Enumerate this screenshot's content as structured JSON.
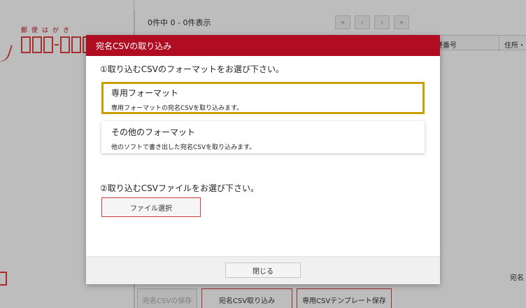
{
  "postcard": {
    "label": "郵便はがき"
  },
  "list": {
    "count_text": "0件中 0 - 0件表示",
    "pager": {
      "first_icon": "double-chevron-left-icon",
      "prev_icon": "chevron-left-icon",
      "next_icon": "chevron-right-icon",
      "last_icon": "double-chevron-right-icon"
    },
    "columns": {
      "zip": "便番号",
      "address": "住所・"
    },
    "right_label": "宛名"
  },
  "bottom_buttons": {
    "save": "宛名CSVの保存",
    "import": "宛名CSV取り込み",
    "template": "専用CSVテンプレート保存"
  },
  "modal": {
    "title": "宛名CSVの取り込み",
    "step1": "①取り込むCSVのフォーマットをお選び下さい。",
    "formats": [
      {
        "title": "専用フォーマット",
        "desc": "専用フォーマットの宛名CSVを取り込みます。",
        "selected": true
      },
      {
        "title": "その他のフォーマット",
        "desc": "他のソフトで書き出した宛名CSVを取り込みます。",
        "selected": false
      }
    ],
    "step2": "②取り込むCSVファイルをお選び下さい。",
    "file_button": "ファイル選択",
    "close_button": "閉じる"
  },
  "colors": {
    "header_red": "#b00d23",
    "selected_border": "#c8a000",
    "button_border": "#d04040"
  }
}
